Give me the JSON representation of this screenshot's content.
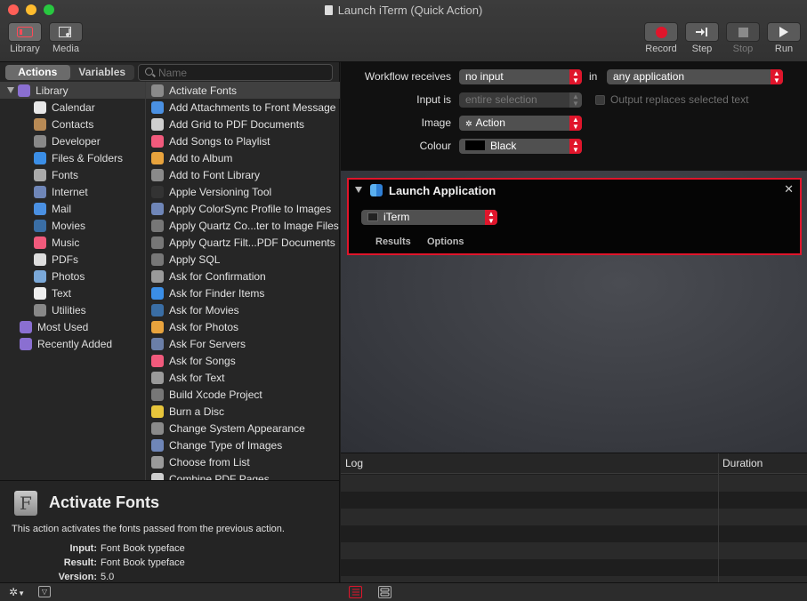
{
  "window": {
    "title": "Launch iTerm (Quick Action)"
  },
  "toolbar": {
    "library_label": "Library",
    "media_label": "Media",
    "record_label": "Record",
    "step_label": "Step",
    "stop_label": "Stop",
    "run_label": "Run"
  },
  "library": {
    "tabs": [
      "Actions",
      "Variables"
    ],
    "search_placeholder": "Name",
    "categories": [
      {
        "label": "Library",
        "icon": "library-icon",
        "color": "#8a6fd1"
      },
      {
        "label": "Calendar",
        "icon": "calendar-icon",
        "color": "#e8e8e8"
      },
      {
        "label": "Contacts",
        "icon": "contacts-icon",
        "color": "#b88a55"
      },
      {
        "label": "Developer",
        "icon": "developer-icon",
        "color": "#888888"
      },
      {
        "label": "Files & Folders",
        "icon": "finder-icon",
        "color": "#3b8ee6"
      },
      {
        "label": "Fonts",
        "icon": "fonts-icon",
        "color": "#aaaaaa"
      },
      {
        "label": "Internet",
        "icon": "internet-icon",
        "color": "#6f86b8"
      },
      {
        "label": "Mail",
        "icon": "mail-icon",
        "color": "#4a90e2"
      },
      {
        "label": "Movies",
        "icon": "movies-icon",
        "color": "#3a6ea5"
      },
      {
        "label": "Music",
        "icon": "music-icon",
        "color": "#f15a7c"
      },
      {
        "label": "PDFs",
        "icon": "pdf-icon",
        "color": "#dddddd"
      },
      {
        "label": "Photos",
        "icon": "photos-icon",
        "color": "#7aa8d8"
      },
      {
        "label": "Text",
        "icon": "text-icon",
        "color": "#eeeeee"
      },
      {
        "label": "Utilities",
        "icon": "utilities-icon",
        "color": "#888888"
      },
      {
        "label": "Most Used",
        "icon": "smart-folder-icon",
        "color": "#8a6fd1"
      },
      {
        "label": "Recently Added",
        "icon": "smart-folder-icon",
        "color": "#8a6fd1"
      }
    ],
    "actions": [
      "Activate Fonts",
      "Add Attachments to Front Message",
      "Add Grid to PDF Documents",
      "Add Songs to Playlist",
      "Add to Album",
      "Add to Font Library",
      "Apple Versioning Tool",
      "Apply ColorSync Profile to Images",
      "Apply Quartz Co...ter to Image Files",
      "Apply Quartz Filt...PDF Documents",
      "Apply SQL",
      "Ask for Confirmation",
      "Ask for Finder Items",
      "Ask for Movies",
      "Ask for Photos",
      "Ask For Servers",
      "Ask for Songs",
      "Ask for Text",
      "Build Xcode Project",
      "Burn a Disc",
      "Change System Appearance",
      "Change Type of Images",
      "Choose from List",
      "Combine PDF Pages"
    ],
    "action_icons": [
      "fonts-icon",
      "mail-icon",
      "pdf-icon",
      "music-icon",
      "photos-icon",
      "fonts-icon",
      "terminal-icon",
      "image-icon",
      "utilities-icon",
      "utilities-icon",
      "utilities-icon",
      "automator-icon",
      "finder-icon",
      "movies-icon",
      "photos-icon",
      "server-icon",
      "music-icon",
      "automator-icon",
      "utilities-icon",
      "burn-icon",
      "system-prefs-icon",
      "image-icon",
      "automator-icon",
      "pdf-icon"
    ]
  },
  "description": {
    "title": "Activate Fonts",
    "text": "This action activates the fonts passed from the previous action.",
    "input_label": "Input:",
    "input_value": "Font Book typeface",
    "result_label": "Result:",
    "result_value": "Font Book typeface",
    "version_label": "Version:",
    "version_value": "5.0"
  },
  "workflow_settings": {
    "receives_label": "Workflow receives",
    "receives_value": "no input",
    "in_label": "in",
    "in_value": "any application",
    "input_is_label": "Input is",
    "input_is_value": "entire selection",
    "replaces_label": "Output replaces selected text",
    "image_label": "Image",
    "image_value": "Action",
    "colour_label": "Colour",
    "colour_value": "Black"
  },
  "action_card": {
    "title": "Launch Application",
    "app_value": "iTerm",
    "tabs": [
      "Results",
      "Options"
    ]
  },
  "log": {
    "log_header": "Log",
    "duration_header": "Duration"
  },
  "colors": {
    "accent_red": "#e0152b"
  }
}
